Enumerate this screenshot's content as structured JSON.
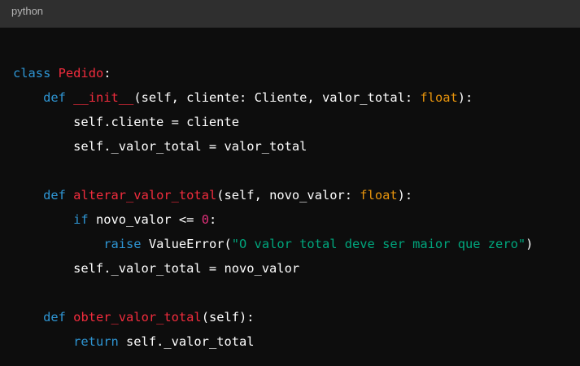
{
  "header": {
    "language": "python"
  },
  "colors": {
    "keyword": "#2e95d3",
    "title": "#f22c3d",
    "built_in": "#e9950c",
    "number": "#df3079",
    "string": "#00a67d",
    "text": "#ffffff",
    "header_bg": "#2f2f2f",
    "code_bg": "#0d0d0d"
  },
  "code_lines": [
    [
      [
        "keyword",
        "class"
      ],
      [
        "plain",
        " "
      ],
      [
        "title",
        "Pedido"
      ],
      [
        "plain",
        ":"
      ]
    ],
    [
      [
        "plain",
        "    "
      ],
      [
        "keyword",
        "def"
      ],
      [
        "plain",
        " "
      ],
      [
        "title",
        "__init__"
      ],
      [
        "plain",
        "(self, cliente: Cliente, valor_total: "
      ],
      [
        "built_in",
        "float"
      ],
      [
        "plain",
        "):"
      ]
    ],
    [
      [
        "plain",
        "        self.cliente = cliente"
      ]
    ],
    [
      [
        "plain",
        "        self._valor_total = valor_total"
      ]
    ],
    [],
    [
      [
        "plain",
        "    "
      ],
      [
        "keyword",
        "def"
      ],
      [
        "plain",
        " "
      ],
      [
        "title",
        "alterar_valor_total"
      ],
      [
        "plain",
        "(self, novo_valor: "
      ],
      [
        "built_in",
        "float"
      ],
      [
        "plain",
        "):"
      ]
    ],
    [
      [
        "plain",
        "        "
      ],
      [
        "keyword",
        "if"
      ],
      [
        "plain",
        " novo_valor <= "
      ],
      [
        "number",
        "0"
      ],
      [
        "plain",
        ":"
      ]
    ],
    [
      [
        "plain",
        "            "
      ],
      [
        "keyword",
        "raise"
      ],
      [
        "plain",
        " ValueError("
      ],
      [
        "string",
        "\"O valor total deve ser maior que zero\""
      ],
      [
        "plain",
        ")"
      ]
    ],
    [
      [
        "plain",
        "        self._valor_total = novo_valor"
      ]
    ],
    [],
    [
      [
        "plain",
        "    "
      ],
      [
        "keyword",
        "def"
      ],
      [
        "plain",
        " "
      ],
      [
        "title",
        "obter_valor_total"
      ],
      [
        "plain",
        "(self):"
      ]
    ],
    [
      [
        "plain",
        "        "
      ],
      [
        "keyword",
        "return"
      ],
      [
        "plain",
        " self._valor_total"
      ]
    ]
  ]
}
